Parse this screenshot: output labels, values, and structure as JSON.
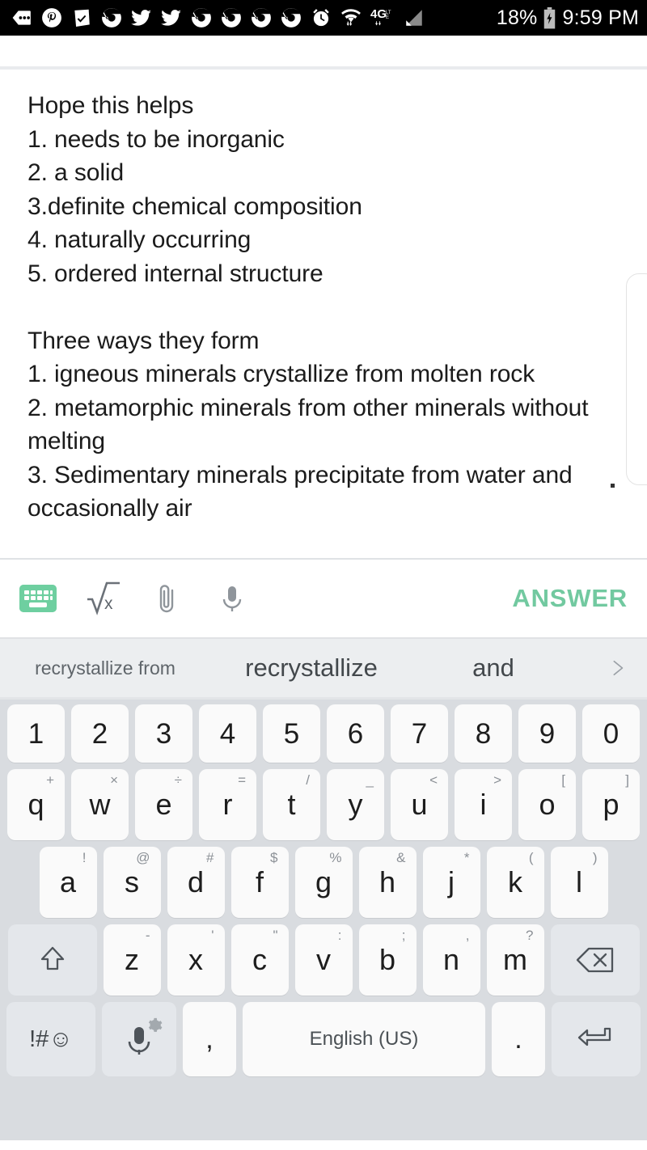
{
  "statusbar": {
    "icons": [
      {
        "name": "tag-dots-icon"
      },
      {
        "name": "pinterest-icon"
      },
      {
        "name": "receipt-check-icon"
      },
      {
        "name": "chrome-icon"
      },
      {
        "name": "twitter-icon"
      },
      {
        "name": "twitter-icon"
      },
      {
        "name": "chrome-icon"
      },
      {
        "name": "chrome-icon"
      },
      {
        "name": "chrome-icon"
      },
      {
        "name": "chrome-icon"
      },
      {
        "name": "alarm-clock-icon"
      },
      {
        "name": "wifi-icon"
      },
      {
        "name": "mobile-data-4g-lte-icon"
      },
      {
        "name": "cell-signal-icon"
      }
    ],
    "network_label": "4G",
    "network_sub": "LTE",
    "battery_percent": "18%",
    "time": "9:59 PM"
  },
  "content": {
    "answer_text": "Hope this helps\n1. needs to be inorganic\n2. a solid\n3.definite chemical composition\n4. naturally occurring\n5. ordered internal structure\n\nThree ways they form\n1. igneous minerals crystallize from molten rock\n2. metamorphic minerals from other minerals without melting\n3. Sedimentary minerals precipitate from water and occasionally air"
  },
  "toolbar": {
    "keyboard_icon": "keyboard-icon",
    "math_icon": "math-sqrt-icon",
    "attach_icon": "paperclip-icon",
    "mic_icon": "microphone-icon",
    "answer_label": "ANSWER"
  },
  "suggestions": {
    "items": [
      "recrystallize from",
      "recrystallize",
      "and"
    ],
    "expand_icon": "chevron-right-icon"
  },
  "keyboard": {
    "rows": {
      "numbers": [
        {
          "main": "1"
        },
        {
          "main": "2"
        },
        {
          "main": "3"
        },
        {
          "main": "4"
        },
        {
          "main": "5"
        },
        {
          "main": "6"
        },
        {
          "main": "7"
        },
        {
          "main": "8"
        },
        {
          "main": "9"
        },
        {
          "main": "0"
        }
      ],
      "qwerty": [
        {
          "main": "q",
          "alt": "+"
        },
        {
          "main": "w",
          "alt": "×"
        },
        {
          "main": "e",
          "alt": "÷"
        },
        {
          "main": "r",
          "alt": "="
        },
        {
          "main": "t",
          "alt": "/"
        },
        {
          "main": "y",
          "alt": "_"
        },
        {
          "main": "u",
          "alt": "<"
        },
        {
          "main": "i",
          "alt": ">"
        },
        {
          "main": "o",
          "alt": "["
        },
        {
          "main": "p",
          "alt": "]"
        }
      ],
      "asdf": [
        {
          "main": "a",
          "alt": "!"
        },
        {
          "main": "s",
          "alt": "@"
        },
        {
          "main": "d",
          "alt": "#"
        },
        {
          "main": "f",
          "alt": "$"
        },
        {
          "main": "g",
          "alt": "%"
        },
        {
          "main": "h",
          "alt": "&"
        },
        {
          "main": "j",
          "alt": "*"
        },
        {
          "main": "k",
          "alt": "("
        },
        {
          "main": "l",
          "alt": ")"
        }
      ],
      "zxcv": [
        {
          "main": "z",
          "alt": "-"
        },
        {
          "main": "x",
          "alt": "'"
        },
        {
          "main": "c",
          "alt": "\""
        },
        {
          "main": "v",
          "alt": ":"
        },
        {
          "main": "b",
          "alt": ";"
        },
        {
          "main": "n",
          "alt": ","
        },
        {
          "main": "m",
          "alt": "?"
        }
      ]
    },
    "shift_icon": "shift-arrow-icon",
    "backspace_icon": "backspace-icon",
    "symbols_label": "!#☺",
    "mic_key_icon": "microphone-icon",
    "comma_label": ",",
    "space_label": "English (US)",
    "period_label": ".",
    "enter_icon": "enter-return-icon"
  },
  "colors": {
    "accent_green": "#6ecfa0",
    "keyboard_bg": "#d9dce0",
    "key_bg": "#fafafa",
    "key_fn_bg": "#e4e7eb",
    "suggestion_bg": "#eceef0",
    "status_bg": "#000000",
    "text": "#1b1b1b"
  }
}
